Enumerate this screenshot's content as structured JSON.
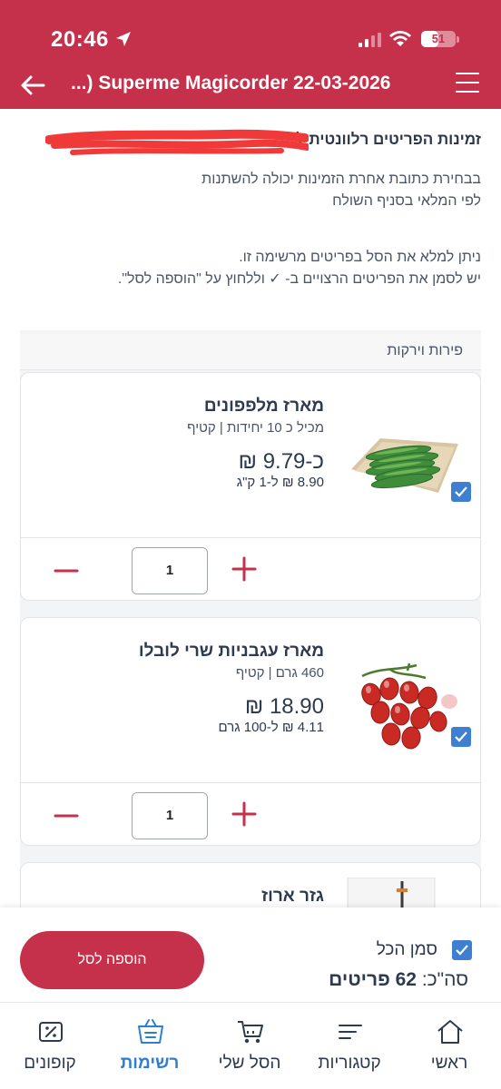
{
  "status_bar": {
    "time": "20:46",
    "battery": "51"
  },
  "header": {
    "title": "...) Superme Magicorder 22-03-2026"
  },
  "info": {
    "title": "זמינות הפריטים רלוונטית ל",
    "subtitle_line1": "בבחירת כתובת אחרת הזמינות יכולה להשתנות",
    "subtitle_line2": "לפי המלאי בסניף השולח",
    "instruction_line1": "ניתן למלא את הסל בפריטים מרשימה זו.",
    "instruction_line2": "יש לסמן את הפריטים הרצויים ב- ✓ וללחוץ על \"הוספה לסל\"."
  },
  "category": {
    "label": "פירות וירקות"
  },
  "products": [
    {
      "name": "מארז מלפפונים",
      "desc": "מכיל כ 10 יחידות | קטיף",
      "price": "כ-9.79 ₪",
      "unit_price": "8.90 ₪ ל-1 ק\"ג",
      "qty": "1",
      "image_icon": "cucumbers-image",
      "checked": true
    },
    {
      "name": "מארז עגבניות שרי לובלו",
      "desc": "460 גרם | קטיף",
      "price": "18.90 ₪",
      "unit_price": "4.11 ₪ ל-100 גרם",
      "qty": "1",
      "image_icon": "cherry-tomatoes-image",
      "checked": true
    },
    {
      "name": "גזר ארוז",
      "image_icon": "carrots-image"
    }
  ],
  "action_bar": {
    "add_to_cart": "הוספה לסל",
    "select_all": "סמן הכל",
    "total_label": "סה\"כ:",
    "total_value": "62 פריטים"
  },
  "tabs": [
    {
      "label": "ראשי",
      "icon": "home-icon"
    },
    {
      "label": "קטגוריות",
      "icon": "categories-icon"
    },
    {
      "label": "הסל שלי",
      "icon": "cart-icon"
    },
    {
      "label": "רשימות",
      "icon": "list-basket-icon",
      "active": true
    },
    {
      "label": "קופונים",
      "icon": "coupon-icon"
    }
  ],
  "colors": {
    "brand": "#c5304a",
    "accent": "#3f7fd1",
    "active_tab": "#2f7fd0"
  }
}
